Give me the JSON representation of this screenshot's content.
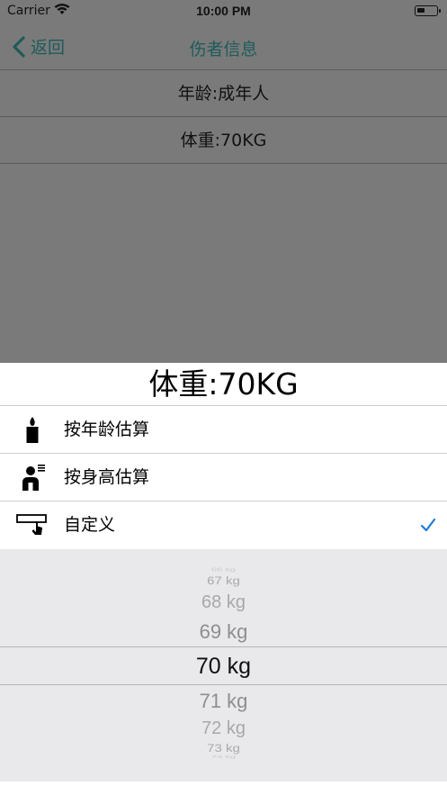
{
  "status_bar": {
    "carrier": "Carrier",
    "time": "10:00 PM"
  },
  "nav": {
    "back_label": "返回",
    "title": "伤者信息"
  },
  "info": {
    "age": "年龄:成年人",
    "weight": "体重:70KG"
  },
  "sheet": {
    "title": "体重:70KG",
    "options": [
      {
        "label": "按年龄估算",
        "icon": "candle-icon",
        "checked": false
      },
      {
        "label": "按身高估算",
        "icon": "person-height-icon",
        "checked": false
      },
      {
        "label": "自定义",
        "icon": "custom-tap-icon",
        "checked": true
      }
    ],
    "picker": {
      "items": [
        "66 kg",
        "67 kg",
        "68 kg",
        "69 kg",
        "70 kg",
        "71 kg",
        "72 kg",
        "73 kg",
        "74 kg"
      ],
      "selected": "70 kg"
    }
  },
  "colors": {
    "accent": "#1d5c5a",
    "check": "#1a7de0",
    "dim": "#7a7a7a",
    "picker_bg": "#e9e9ec"
  }
}
